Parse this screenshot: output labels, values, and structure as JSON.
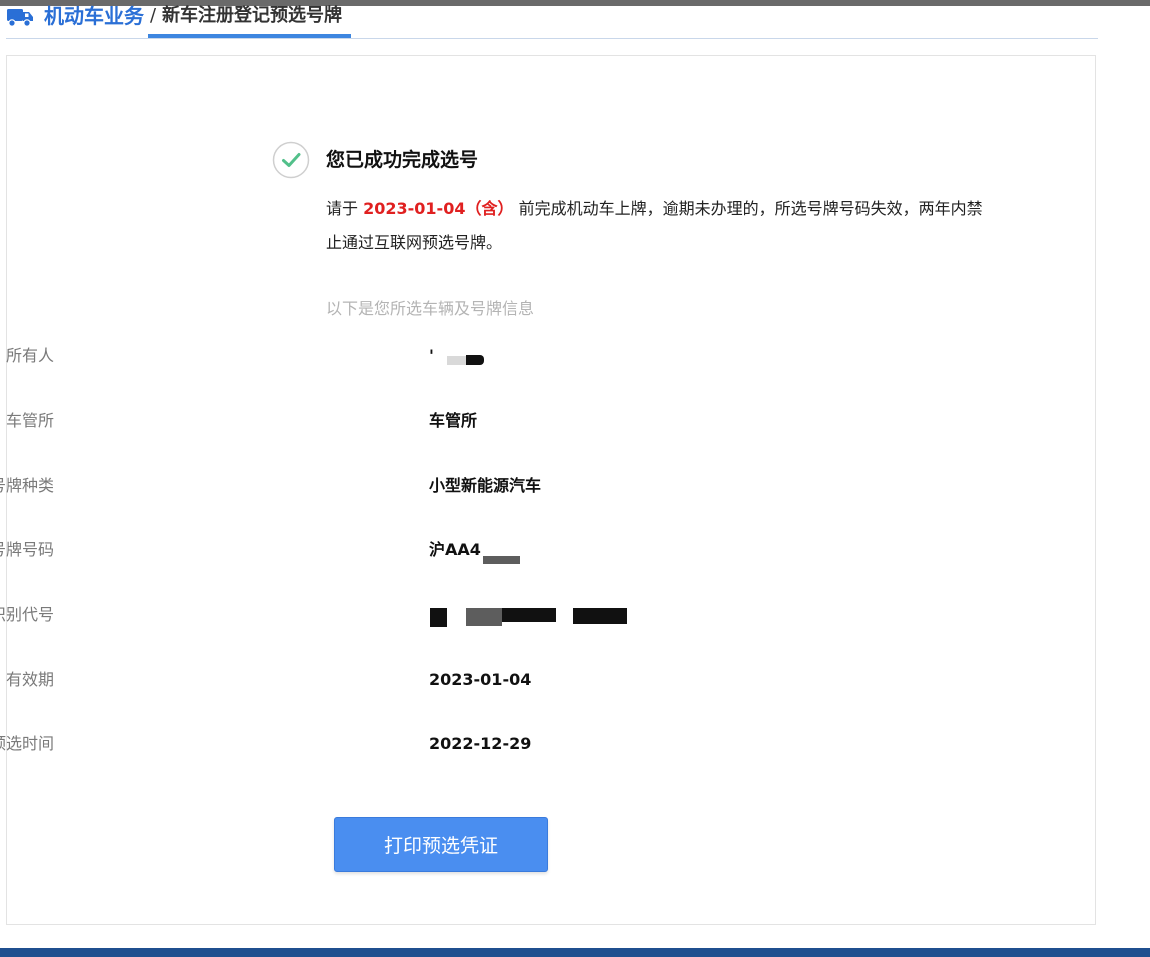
{
  "header": {
    "breadcrumb_root": "机动车业务",
    "breadcrumb_separator": "/",
    "breadcrumb_current": "新车注册登记预选号牌"
  },
  "result": {
    "title": "您已成功完成选号",
    "notice_prefix": "请于",
    "deadline": "2023-01-04（含）",
    "notice_suffix": "前完成机动车上牌，逾期未办理的，所选号牌号码失效，两年内禁止通过互联网预选号牌。"
  },
  "vehicle_info": {
    "hint": "以下是您所选车辆及号牌信息",
    "rows": [
      {
        "label": "所有人",
        "value": "'"
      },
      {
        "label": "车管所",
        "value": "车管所"
      },
      {
        "label": "号牌种类",
        "value": "小型新能源汽车"
      },
      {
        "label": "号牌号码",
        "value": "沪AA4"
      },
      {
        "label": "车辆识别代号",
        "value": ""
      },
      {
        "label": "有效期",
        "value": "2023-01-04"
      },
      {
        "label": "预选时间",
        "value": "2022-12-29"
      }
    ]
  },
  "actions": {
    "print_label": "打印预选凭证"
  },
  "colors": {
    "brand_blue": "#2a6fd6",
    "button_blue": "#4a8ef0",
    "deadline_red": "#e02020",
    "success_green": "#52c08a"
  },
  "icons": {
    "header": "truck-icon",
    "success": "check-circle-icon"
  }
}
